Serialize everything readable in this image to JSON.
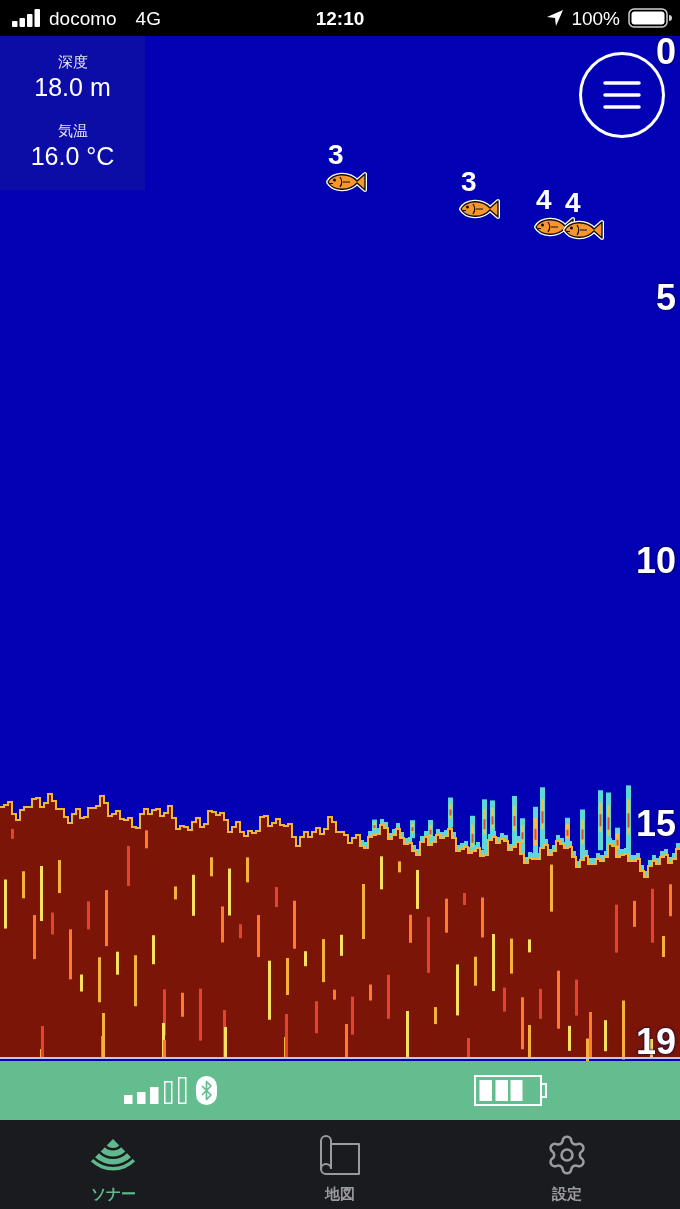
{
  "status_bar": {
    "carrier": "docomo",
    "network": "4G",
    "time": "12:10",
    "battery": "100%"
  },
  "sonar": {
    "readouts": [
      {
        "label": "深度",
        "value": "18.0 m"
      },
      {
        "label": "気温",
        "value": "16.0 °C"
      }
    ],
    "depth_scale": [
      "0",
      "5",
      "10",
      "15",
      "19"
    ],
    "fish": [
      {
        "depth": "3"
      },
      {
        "depth": "3"
      },
      {
        "depth": "4"
      },
      {
        "depth": "4"
      }
    ]
  },
  "tabs": [
    {
      "label": "ソナー",
      "selected": true
    },
    {
      "label": "地図",
      "selected": false
    },
    {
      "label": "設定",
      "selected": false
    }
  ]
}
